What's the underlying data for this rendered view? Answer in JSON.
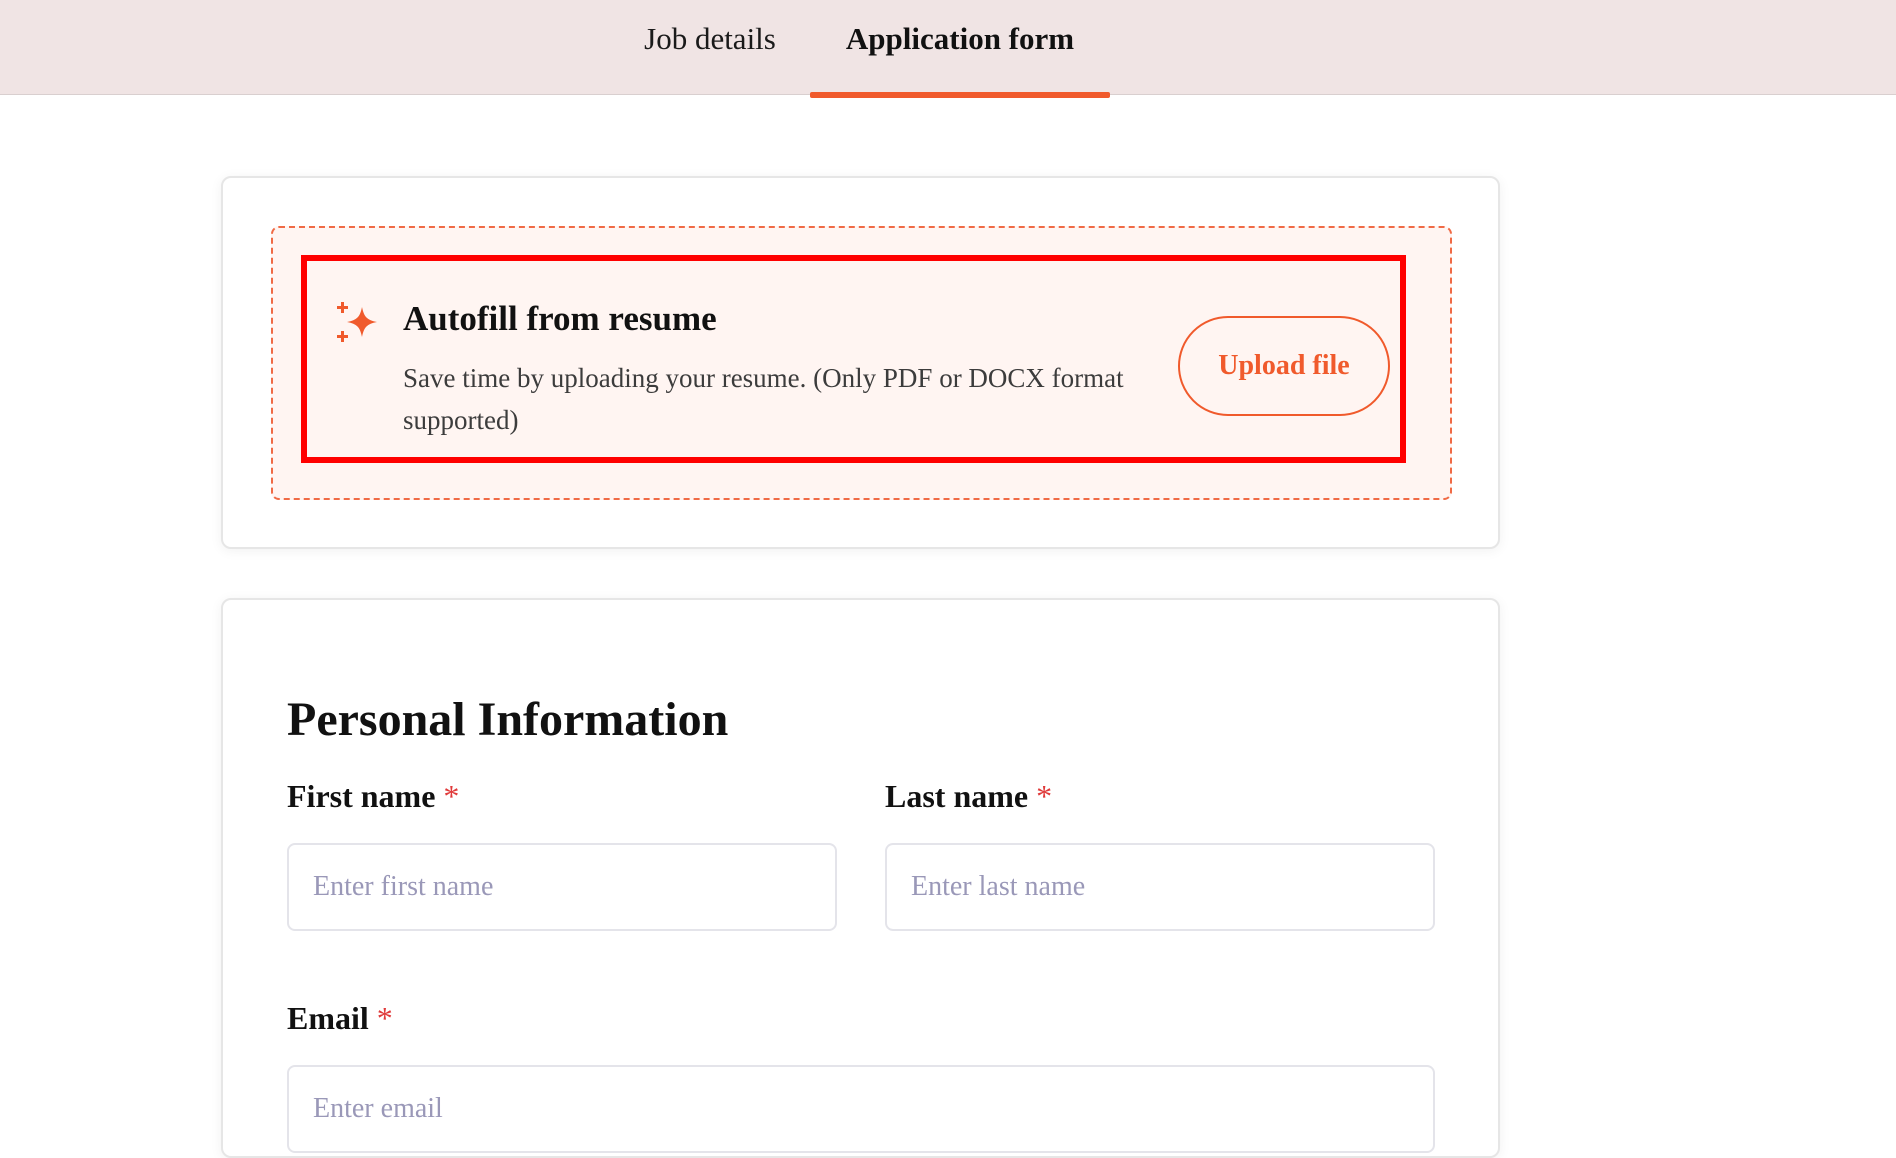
{
  "tabs": [
    {
      "label": "Job details",
      "active": false
    },
    {
      "label": "Application form",
      "active": true
    }
  ],
  "colors": {
    "accent": "#f05a2c",
    "tabbar_bg": "#f0e4e4",
    "highlight": "#ff0000",
    "required": "#e03a3a"
  },
  "autofill": {
    "icon": "sparkle-icon",
    "title": "Autofill from resume",
    "description": "Save time by uploading your resume. (Only PDF or DOCX format supported)",
    "button_label": "Upload file"
  },
  "personal": {
    "title": "Personal Information",
    "required_mark": "*",
    "first_name": {
      "label": "First name",
      "placeholder": "Enter first name"
    },
    "last_name": {
      "label": "Last name",
      "placeholder": "Enter last name"
    },
    "email": {
      "label": "Email",
      "placeholder": "Enter email"
    }
  }
}
